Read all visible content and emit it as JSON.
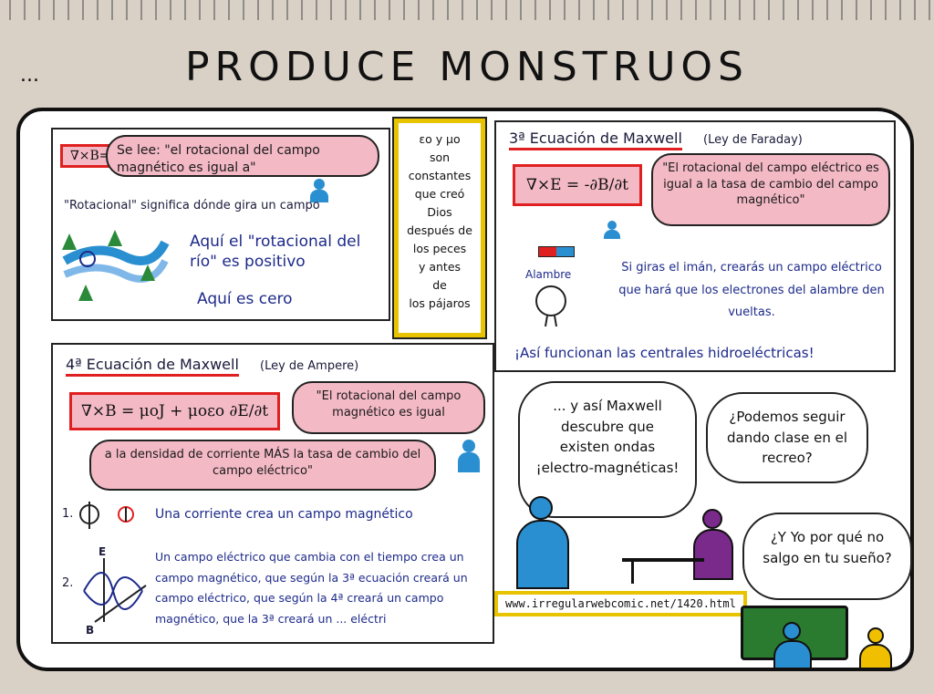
{
  "title": "PRODUCE MONSTRUOS",
  "ellipsis": "...",
  "panel1": {
    "eq": "∇×B=",
    "bubble": "Se lee: \"el rotacional del campo magnético es igual a\"",
    "rot_def": "\"Rotacional\" significa dónde gira un campo",
    "river_pos": "Aquí el \"rotacional del río\" es positivo",
    "river_zero": "Aquí es cero"
  },
  "middle_note": [
    "εo y μo",
    "son",
    "constantes",
    "que creó",
    "Dios",
    "después de",
    "los peces",
    "y antes",
    "de",
    "los pájaros"
  ],
  "panel3": {
    "heading": "3ª Ecuación de Maxwell",
    "subtitle": "(Ley de Faraday)",
    "eq": "∇×E = -∂B/∂t",
    "bubble": "\"El rotacional del campo eléctrico es igual a la tasa de cambio del campo magnético\"",
    "wire_label": "Alambre",
    "text": "Si giras el imán, crearás un campo eléctrico que hará que los electrones del alambre den vueltas.",
    "conclusion": "¡Así funcionan las centrales hidroeléctricas!"
  },
  "panel4": {
    "heading": "4ª Ecuación de Maxwell",
    "subtitle": "(Ley de Ampere)",
    "eq": "∇×B = μoJ + μoεo ∂E/∂t",
    "bubble_top": "\"El rotacional del campo magnético es igual",
    "bubble_bottom": "a la densidad de corriente MÁS la tasa de cambio del campo eléctrico\"",
    "item1_num": "1.",
    "item1": "Una corriente crea un campo magnético",
    "item2_num": "2.",
    "item2": "Un campo eléctrico que cambia con el tiempo crea un campo magnético, que según la 3ª ecuación creará un campo eléctrico, que según la 4ª creará un campo magnético, que la 3ª creará un ... eléctri",
    "axis_e": "E",
    "axis_b": "B"
  },
  "scene": {
    "bubble_maxwell": "... y así Maxwell descubre que existen ondas ¡electro-magnéticas!",
    "bubble_student": "¿Podemos seguir dando clase en el recreo?",
    "bubble_kid": "¿Y Yo por qué no salgo en tu sueño?",
    "url": "www.irregularwebcomic.net/1420.html"
  },
  "colors": {
    "pink": "#f3b9c5",
    "red": "#e02020",
    "yellow": "#e8c400",
    "teacher": "#2a8fd0",
    "student": "#7a2a8a",
    "kid": "#f0c000",
    "board": "#2a7a30"
  }
}
